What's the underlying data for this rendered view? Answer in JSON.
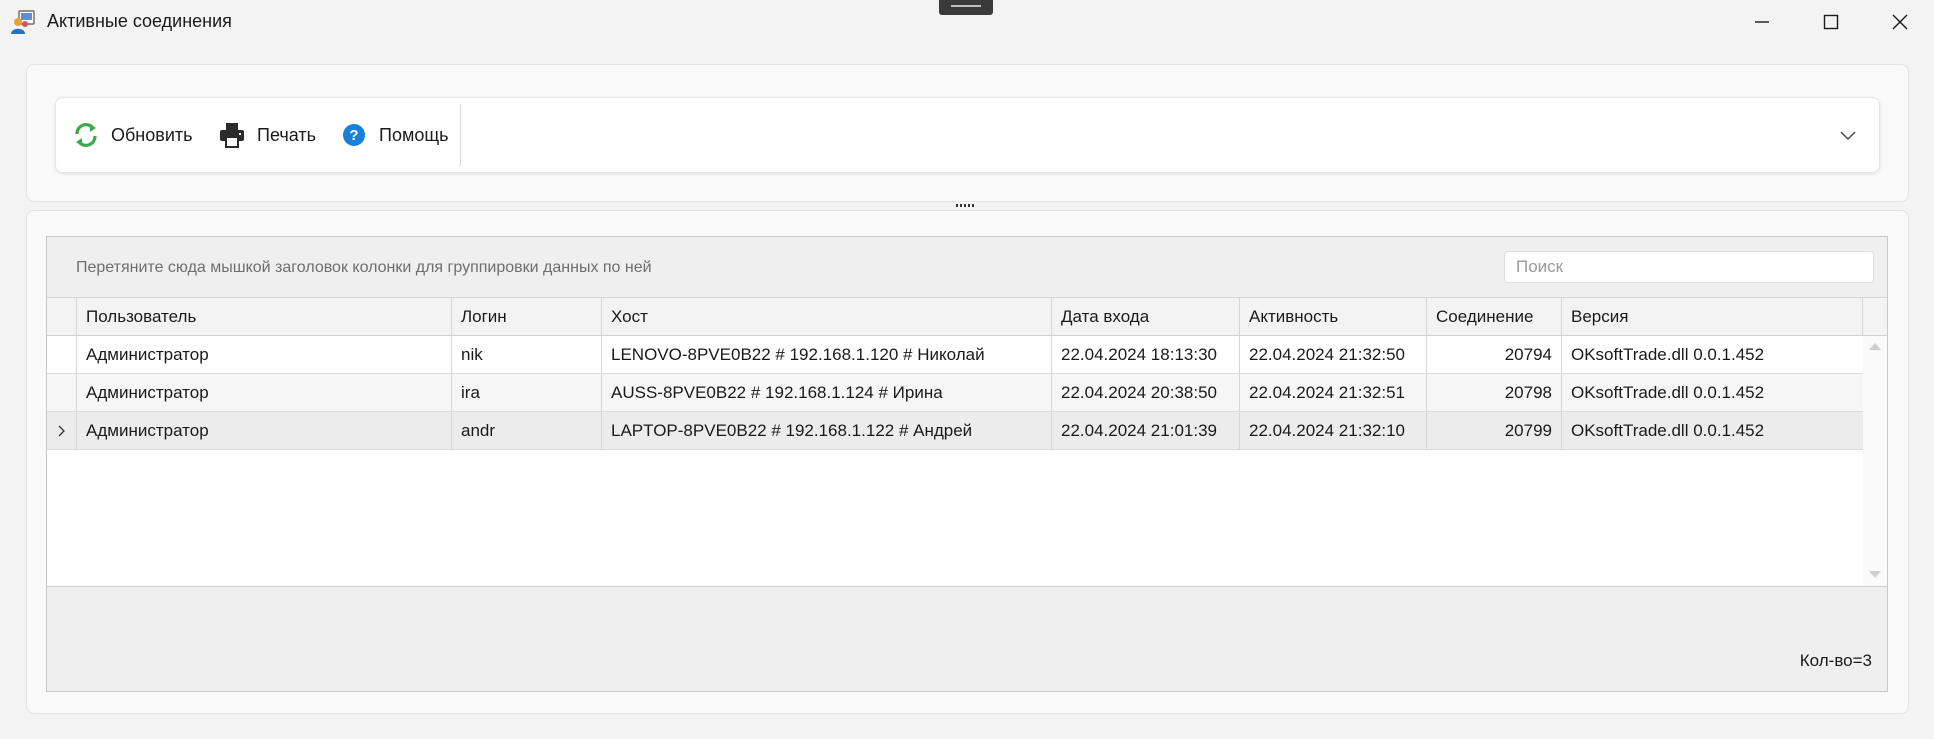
{
  "window": {
    "title": "Активные соединения",
    "controls": [
      "minimize-icon",
      "maximize-icon",
      "close-icon"
    ]
  },
  "toolbar": {
    "refresh_label": "Обновить",
    "print_label": "Печать",
    "help_label": "Помощь",
    "icons": {
      "refresh": "refresh-icon",
      "print": "printer-icon",
      "help": "help-icon",
      "expand": "chevron-down-icon"
    },
    "colors": {
      "refresh": "#3fa84a",
      "print": "#2b2b2b",
      "help": "#1a7fd6"
    }
  },
  "grid": {
    "group_hint": "Перетяните сюда мышкой заголовок колонки для группировки данных по ней",
    "search_placeholder": "Поиск",
    "columns": [
      "Пользователь",
      "Логин",
      "Хост",
      "Дата входа",
      "Активность",
      "Соединение",
      "Версия"
    ],
    "rows": [
      {
        "user": "Администратор",
        "login": "nik",
        "host": "LENOVO-8PVE0B22 # 192.168.1.120 # Николай",
        "login_date": "22.04.2024 18:13:30",
        "activity": "22.04.2024 21:32:50",
        "connection": "20794",
        "version": "OKsoftTrade.dll 0.0.1.452"
      },
      {
        "user": "Администратор",
        "login": "ira",
        "host": "AUSS-8PVE0B22 # 192.168.1.124 # Ирина",
        "login_date": "22.04.2024 20:38:50",
        "activity": "22.04.2024 21:32:51",
        "connection": "20798",
        "version": "OKsoftTrade.dll 0.0.1.452"
      },
      {
        "user": "Администратор",
        "login": "andr",
        "host": "LAPTOP-8PVE0B22 # 192.168.1.122 # Андрей",
        "login_date": "22.04.2024 21:01:39",
        "activity": "22.04.2024 21:32:10",
        "connection": "20799",
        "version": "OKsoftTrade.dll 0.0.1.452"
      }
    ],
    "focused_row": 2,
    "count_label": "Кол-во=3"
  }
}
